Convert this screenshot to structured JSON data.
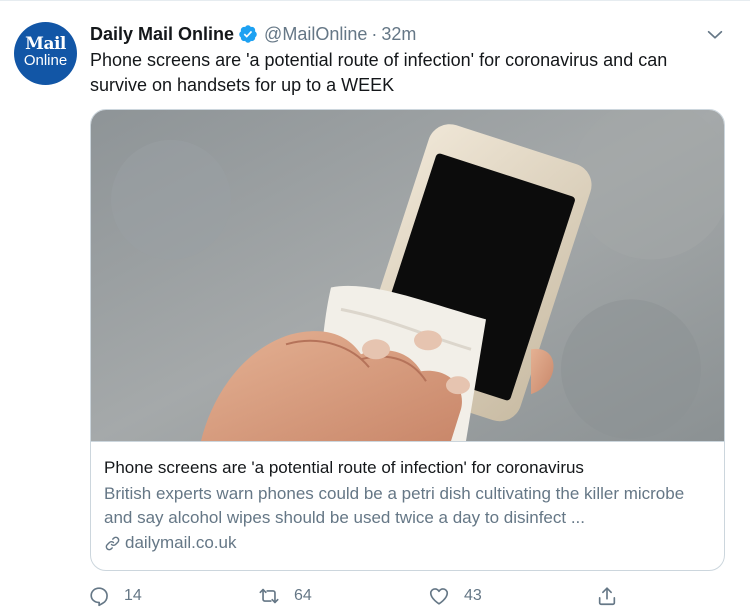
{
  "account": {
    "display_name": "Daily Mail Online",
    "handle": "@MailOnline",
    "separator": "·",
    "time": "32m",
    "avatar_line1": "Mail",
    "avatar_line2": "Online"
  },
  "tweet": {
    "text": "Phone screens are 'a potential route of infection' for coronavirus and can survive on handsets for up to a WEEK"
  },
  "card": {
    "title": "Phone screens are 'a potential route of infection' for coronavirus",
    "description": "British experts warn phones could be a petri dish cultivating the killer microbe and say alcohol wipes should be used twice a day to disinfect ...",
    "domain": "dailymail.co.uk"
  },
  "actions": {
    "reply_count": "14",
    "retweet_count": "64",
    "like_count": "43"
  },
  "icons": {
    "verified": "verified-badge-icon",
    "more": "chevron-down-icon",
    "link": "link-icon",
    "reply": "reply-icon",
    "retweet": "retweet-icon",
    "like": "heart-icon",
    "share": "share-icon"
  },
  "colors": {
    "brand_blue": "#1da1f2",
    "avatar_bg": "#1256a6",
    "text_primary": "#14171a",
    "text_secondary": "#657786",
    "border": "#ccd6dd"
  }
}
